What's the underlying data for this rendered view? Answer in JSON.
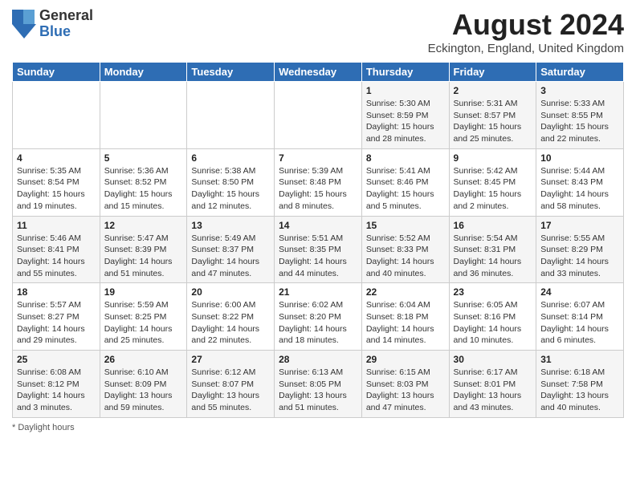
{
  "header": {
    "logo_general": "General",
    "logo_blue": "Blue",
    "month_title": "August 2024",
    "location": "Eckington, England, United Kingdom"
  },
  "weekdays": [
    "Sunday",
    "Monday",
    "Tuesday",
    "Wednesday",
    "Thursday",
    "Friday",
    "Saturday"
  ],
  "footer": {
    "note": "Daylight hours"
  },
  "weeks": [
    [
      {
        "day": "",
        "info": ""
      },
      {
        "day": "",
        "info": ""
      },
      {
        "day": "",
        "info": ""
      },
      {
        "day": "",
        "info": ""
      },
      {
        "day": "1",
        "info": "Sunrise: 5:30 AM\nSunset: 8:59 PM\nDaylight: 15 hours\nand 28 minutes."
      },
      {
        "day": "2",
        "info": "Sunrise: 5:31 AM\nSunset: 8:57 PM\nDaylight: 15 hours\nand 25 minutes."
      },
      {
        "day": "3",
        "info": "Sunrise: 5:33 AM\nSunset: 8:55 PM\nDaylight: 15 hours\nand 22 minutes."
      }
    ],
    [
      {
        "day": "4",
        "info": "Sunrise: 5:35 AM\nSunset: 8:54 PM\nDaylight: 15 hours\nand 19 minutes."
      },
      {
        "day": "5",
        "info": "Sunrise: 5:36 AM\nSunset: 8:52 PM\nDaylight: 15 hours\nand 15 minutes."
      },
      {
        "day": "6",
        "info": "Sunrise: 5:38 AM\nSunset: 8:50 PM\nDaylight: 15 hours\nand 12 minutes."
      },
      {
        "day": "7",
        "info": "Sunrise: 5:39 AM\nSunset: 8:48 PM\nDaylight: 15 hours\nand 8 minutes."
      },
      {
        "day": "8",
        "info": "Sunrise: 5:41 AM\nSunset: 8:46 PM\nDaylight: 15 hours\nand 5 minutes."
      },
      {
        "day": "9",
        "info": "Sunrise: 5:42 AM\nSunset: 8:45 PM\nDaylight: 15 hours\nand 2 minutes."
      },
      {
        "day": "10",
        "info": "Sunrise: 5:44 AM\nSunset: 8:43 PM\nDaylight: 14 hours\nand 58 minutes."
      }
    ],
    [
      {
        "day": "11",
        "info": "Sunrise: 5:46 AM\nSunset: 8:41 PM\nDaylight: 14 hours\nand 55 minutes."
      },
      {
        "day": "12",
        "info": "Sunrise: 5:47 AM\nSunset: 8:39 PM\nDaylight: 14 hours\nand 51 minutes."
      },
      {
        "day": "13",
        "info": "Sunrise: 5:49 AM\nSunset: 8:37 PM\nDaylight: 14 hours\nand 47 minutes."
      },
      {
        "day": "14",
        "info": "Sunrise: 5:51 AM\nSunset: 8:35 PM\nDaylight: 14 hours\nand 44 minutes."
      },
      {
        "day": "15",
        "info": "Sunrise: 5:52 AM\nSunset: 8:33 PM\nDaylight: 14 hours\nand 40 minutes."
      },
      {
        "day": "16",
        "info": "Sunrise: 5:54 AM\nSunset: 8:31 PM\nDaylight: 14 hours\nand 36 minutes."
      },
      {
        "day": "17",
        "info": "Sunrise: 5:55 AM\nSunset: 8:29 PM\nDaylight: 14 hours\nand 33 minutes."
      }
    ],
    [
      {
        "day": "18",
        "info": "Sunrise: 5:57 AM\nSunset: 8:27 PM\nDaylight: 14 hours\nand 29 minutes."
      },
      {
        "day": "19",
        "info": "Sunrise: 5:59 AM\nSunset: 8:25 PM\nDaylight: 14 hours\nand 25 minutes."
      },
      {
        "day": "20",
        "info": "Sunrise: 6:00 AM\nSunset: 8:22 PM\nDaylight: 14 hours\nand 22 minutes."
      },
      {
        "day": "21",
        "info": "Sunrise: 6:02 AM\nSunset: 8:20 PM\nDaylight: 14 hours\nand 18 minutes."
      },
      {
        "day": "22",
        "info": "Sunrise: 6:04 AM\nSunset: 8:18 PM\nDaylight: 14 hours\nand 14 minutes."
      },
      {
        "day": "23",
        "info": "Sunrise: 6:05 AM\nSunset: 8:16 PM\nDaylight: 14 hours\nand 10 minutes."
      },
      {
        "day": "24",
        "info": "Sunrise: 6:07 AM\nSunset: 8:14 PM\nDaylight: 14 hours\nand 6 minutes."
      }
    ],
    [
      {
        "day": "25",
        "info": "Sunrise: 6:08 AM\nSunset: 8:12 PM\nDaylight: 14 hours\nand 3 minutes."
      },
      {
        "day": "26",
        "info": "Sunrise: 6:10 AM\nSunset: 8:09 PM\nDaylight: 13 hours\nand 59 minutes."
      },
      {
        "day": "27",
        "info": "Sunrise: 6:12 AM\nSunset: 8:07 PM\nDaylight: 13 hours\nand 55 minutes."
      },
      {
        "day": "28",
        "info": "Sunrise: 6:13 AM\nSunset: 8:05 PM\nDaylight: 13 hours\nand 51 minutes."
      },
      {
        "day": "29",
        "info": "Sunrise: 6:15 AM\nSunset: 8:03 PM\nDaylight: 13 hours\nand 47 minutes."
      },
      {
        "day": "30",
        "info": "Sunrise: 6:17 AM\nSunset: 8:01 PM\nDaylight: 13 hours\nand 43 minutes."
      },
      {
        "day": "31",
        "info": "Sunrise: 6:18 AM\nSunset: 7:58 PM\nDaylight: 13 hours\nand 40 minutes."
      }
    ]
  ]
}
